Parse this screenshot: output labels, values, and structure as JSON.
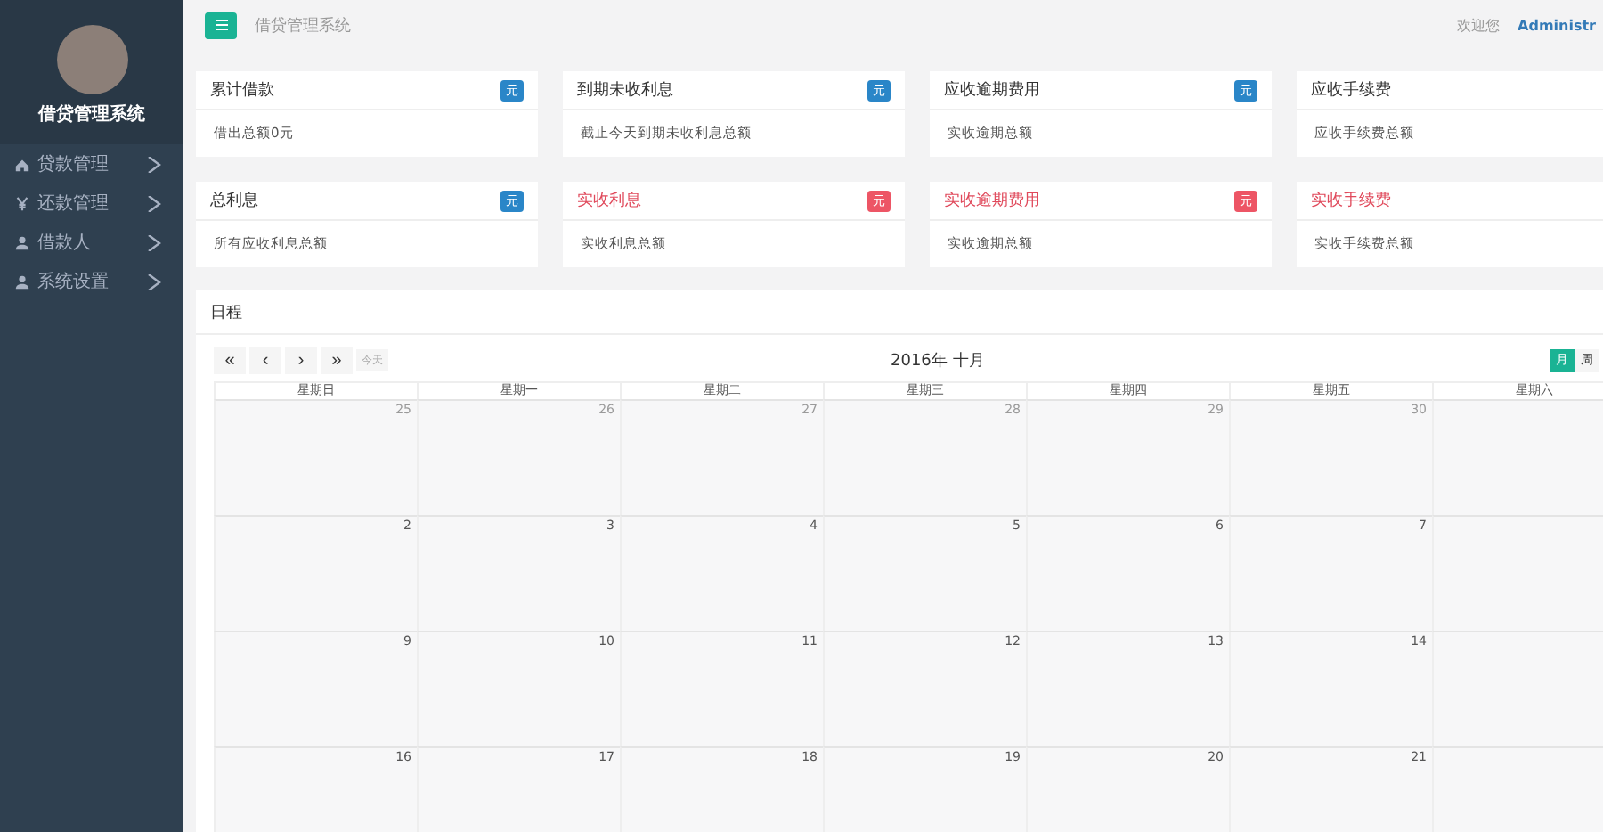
{
  "sidebar": {
    "app_name": "借贷管理系统",
    "items": [
      {
        "kind": "home",
        "label": "贷款管理",
        "expanded": false
      },
      {
        "kind": "money",
        "label": "还款管理",
        "expanded": false
      },
      {
        "kind": "person",
        "label": "借款人",
        "expanded": false
      },
      {
        "kind": "person",
        "label": "系统设置",
        "expanded": false
      }
    ]
  },
  "topbar": {
    "breadcrumb": "借贷管理系统",
    "welcome": "欢迎您",
    "user": "Administr"
  },
  "cards": [
    {
      "title": "累计借款",
      "badge": "元",
      "highlighted": false,
      "text": "借出总额0元"
    },
    {
      "title": "到期未收利息",
      "badge": "元",
      "highlighted": false,
      "text": "截止今天到期未收利息总额"
    },
    {
      "title": "应收逾期费用",
      "badge": "元",
      "highlighted": false,
      "text": "实收逾期总额"
    },
    {
      "title": "应收手续费",
      "highlighted": false,
      "text": "应收手续费总额"
    },
    {
      "title": "总利息",
      "badge": "元",
      "highlighted": false,
      "text": "所有应收利息总额"
    },
    {
      "title": "实收利息",
      "badge": "元",
      "highlighted": true,
      "text": "实收利息总额"
    },
    {
      "title": "实收逾期费用",
      "badge": "元",
      "highlighted": true,
      "text": "实收逾期总额"
    },
    {
      "title": "实收手续费",
      "highlighted": true,
      "text": "实收手续费总额"
    }
  ],
  "calendar": {
    "title": "日程",
    "nav": [
      "«",
      "‹",
      "›",
      "»"
    ],
    "today": "今天",
    "heading": "2016年 十月",
    "views": [
      {
        "label": "月",
        "selected": true
      },
      {
        "label": "周",
        "selected": false
      }
    ],
    "weekdays": [
      "星期日",
      "星期一",
      "星期二",
      "星期三",
      "星期四",
      "星期五",
      "星期六"
    ],
    "weeks": [
      {
        "days": [
          {
            "label": "25",
            "other_month": true
          },
          {
            "label": "26",
            "other_month": true
          },
          {
            "label": "27",
            "other_month": true
          },
          {
            "label": "28",
            "other_month": true
          },
          {
            "label": "29",
            "other_month": true
          },
          {
            "label": "30",
            "other_month": true
          }
        ]
      },
      {
        "days": [
          {
            "label": "2",
            "other_month": false
          },
          {
            "label": "3",
            "other_month": false
          },
          {
            "label": "4",
            "other_month": false
          },
          {
            "label": "5",
            "other_month": false
          },
          {
            "label": "6",
            "other_month": false
          },
          {
            "label": "7",
            "other_month": false
          }
        ]
      },
      {
        "days": [
          {
            "label": "9",
            "other_month": false
          },
          {
            "label": "10",
            "other_month": false
          },
          {
            "label": "11",
            "other_month": false
          },
          {
            "label": "12",
            "other_month": false
          },
          {
            "label": "13",
            "other_month": false
          },
          {
            "label": "14",
            "other_month": false
          }
        ]
      },
      {
        "days": [
          {
            "label": "16",
            "other_month": false
          },
          {
            "label": "17",
            "other_month": false
          },
          {
            "label": "18",
            "other_month": false
          },
          {
            "label": "19",
            "other_month": false
          },
          {
            "label": "20",
            "other_month": false
          },
          {
            "label": "21",
            "other_month": false
          }
        ]
      }
    ]
  }
}
